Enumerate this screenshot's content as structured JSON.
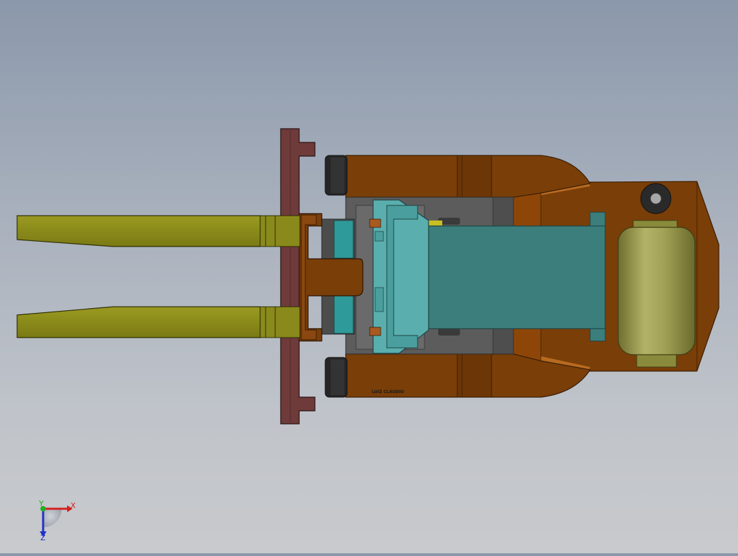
{
  "model": {
    "engraving": "LUIZ CLAUDIO",
    "colors": {
      "forks": "#8a8a1c",
      "carriage_plate": "#6e3a3a",
      "chassis": "#7a3e08",
      "body_highlight": "#8e4608",
      "mast": "#4a9e9e",
      "mast_dark": "#3b7e7c",
      "tank": "#a9a95a",
      "wheel": "#262626",
      "frame": "#5a5a5a"
    }
  },
  "triad": {
    "x_label": "X",
    "y_label": "Y",
    "z_label": "Z",
    "x_color": "#d42020",
    "y_color": "#20b020",
    "z_color": "#2030c8"
  }
}
